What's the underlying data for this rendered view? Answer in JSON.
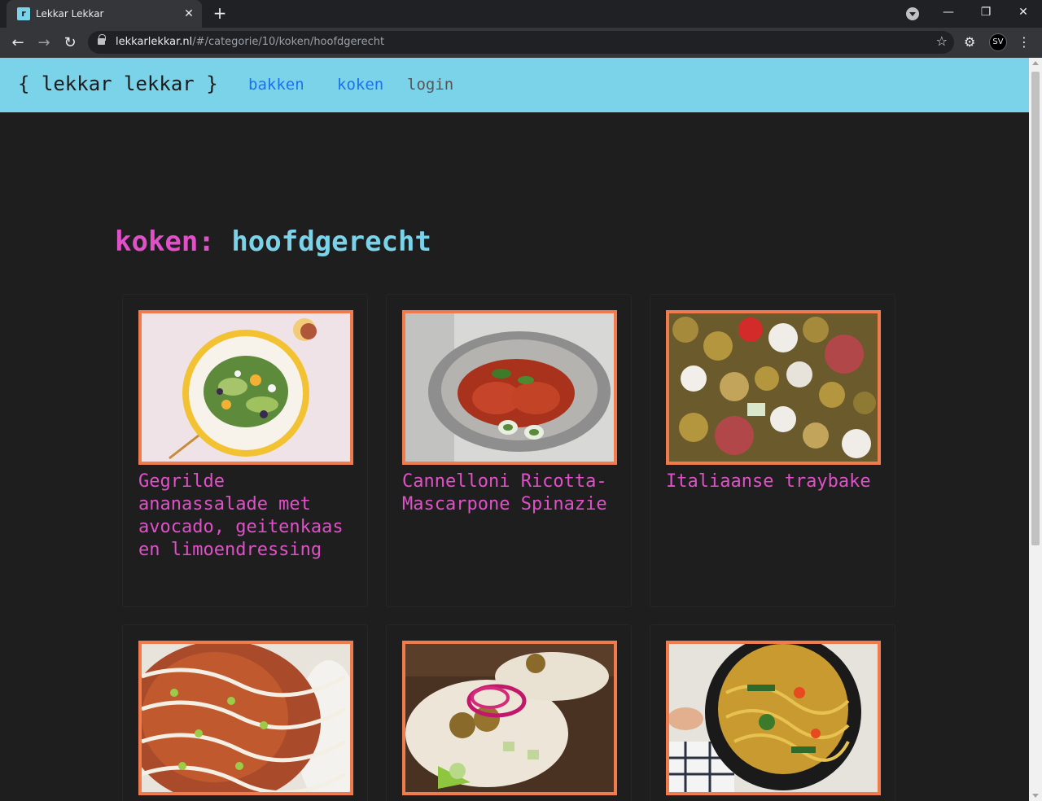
{
  "browser": {
    "tab_title": "Lekkar Lekkar",
    "favicon_letter": "r",
    "tab_close": "✕",
    "new_tab": "+",
    "url_host": "lekkarlekkar.nl",
    "url_path": "/#/categorie/10/koken/hoofdgerecht",
    "profile_initials": "SV",
    "icons": {
      "back": "←",
      "forward": "→",
      "reload": "↻",
      "star": "☆",
      "extensions": "⚙",
      "menu": "⋮",
      "minimize": "—",
      "restore": "❐",
      "close": "✕"
    }
  },
  "site": {
    "logo": "{ lekkar lekkar }",
    "nav": [
      {
        "label": "bakken"
      },
      {
        "label": "koken"
      },
      {
        "label": "login"
      }
    ]
  },
  "page": {
    "category": "koken:",
    "subcategory": "hoofdgerecht"
  },
  "recipes": [
    {
      "title": "Gegrilde ananassalade met avocado, geitenkaas en limoendressing",
      "image": "salad-plate-image"
    },
    {
      "title": "Cannelloni Ricotta-Mascarpone Spinazie",
      "image": "cannelloni-image"
    },
    {
      "title": "Italiaanse traybake",
      "image": "traybake-image"
    },
    {
      "title": "",
      "image": "flatbread-image"
    },
    {
      "title": "",
      "image": "tacos-image"
    },
    {
      "title": "",
      "image": "noodles-image"
    }
  ],
  "colors": {
    "header_bg": "#7bd3ea",
    "page_bg": "#1e1e1e",
    "accent_pink": "#e050c8",
    "accent_cyan": "#7bd3ea",
    "image_border": "#f07c4e",
    "nav_link_blue": "#1a73e8"
  }
}
